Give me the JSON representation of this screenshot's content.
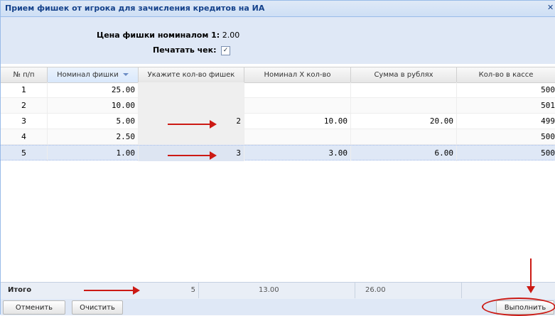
{
  "window": {
    "title": "Прием фишек от игрока для зачисления кредитов на ИА"
  },
  "form": {
    "price_label": "Цена фишки номиналом 1:",
    "price_value": "2.00",
    "print_label": "Печатать чек:",
    "print_checked": "✓"
  },
  "grid": {
    "columns": [
      "№ п/п",
      "Номинал фишки",
      "Укажите кол-во фишек",
      "Номинал Х кол-во",
      "Сумма в рублях",
      "Кол-во в кассе"
    ],
    "sort_icon": "sort-desc-icon",
    "rows": [
      {
        "n": "1",
        "nominal": "25.00",
        "qty": "",
        "product": "",
        "sum": "",
        "cash": "500"
      },
      {
        "n": "2",
        "nominal": "10.00",
        "qty": "",
        "product": "",
        "sum": "",
        "cash": "501"
      },
      {
        "n": "3",
        "nominal": "5.00",
        "qty": "2",
        "product": "10.00",
        "sum": "20.00",
        "cash": "499"
      },
      {
        "n": "4",
        "nominal": "2.50",
        "qty": "",
        "product": "",
        "sum": "",
        "cash": "500"
      },
      {
        "n": "5",
        "nominal": "1.00",
        "qty": "3",
        "product": "3.00",
        "sum": "6.00",
        "cash": "500"
      }
    ]
  },
  "totals": {
    "label": "Итого",
    "qty": "5",
    "product": "13.00",
    "sum": "26.00"
  },
  "buttons": {
    "cancel": "Отменить",
    "clear": "Очистить",
    "execute": "Выполнить"
  },
  "colors": {
    "accent": "#15428b",
    "annotation": "#cc1a14",
    "panel": "#dfe8f6"
  }
}
